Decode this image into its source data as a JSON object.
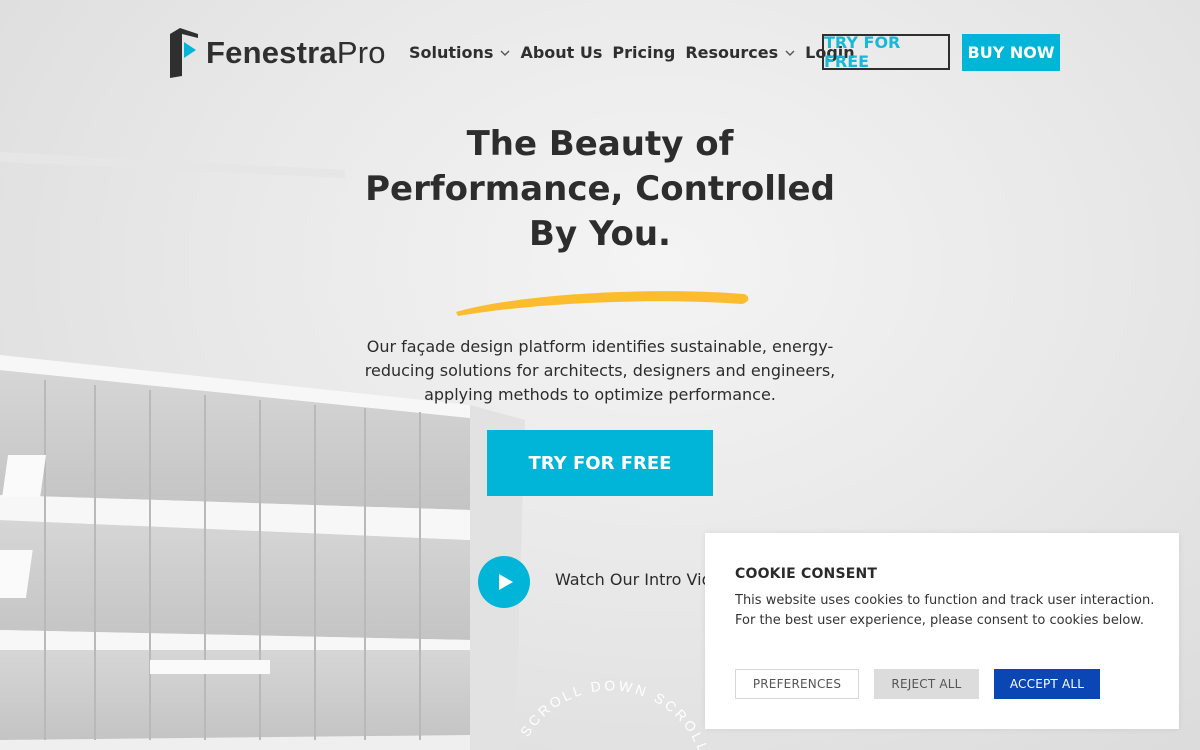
{
  "brand": {
    "name_bold": "Fenestra",
    "name_regular": "Pro",
    "accent_color": "#00b5d8"
  },
  "nav": {
    "items": [
      {
        "label": "Solutions",
        "dropdown": true
      },
      {
        "label": "About Us",
        "dropdown": false
      },
      {
        "label": "Pricing",
        "dropdown": false
      },
      {
        "label": "Resources",
        "dropdown": true
      },
      {
        "label": "Login",
        "dropdown": false
      }
    ],
    "try_label": "TRY FOR FREE",
    "buy_label": "BUY NOW"
  },
  "hero": {
    "title": "The Beauty of Performance, Controlled By You.",
    "description": "Our façade design platform identifies sustainable, energy-reducing solutions for architects, designers and engineers, applying methods to optimize performance.",
    "cta_label": "TRY FOR FREE",
    "video_label": "Watch Our Intro Vid",
    "scroll_text": "SCROLL DOWN SCROLL DOWN",
    "swoosh_color": "#fbbd2e"
  },
  "cookie": {
    "title": "COOKIE CONSENT",
    "text": "This website uses cookies to function and track user interaction. For the best user experience, please consent to cookies below.",
    "preferences_label": "PREFERENCES",
    "reject_label": "REJECT ALL",
    "accept_label": "ACCEPT ALL",
    "accept_color": "#0a47b5"
  }
}
